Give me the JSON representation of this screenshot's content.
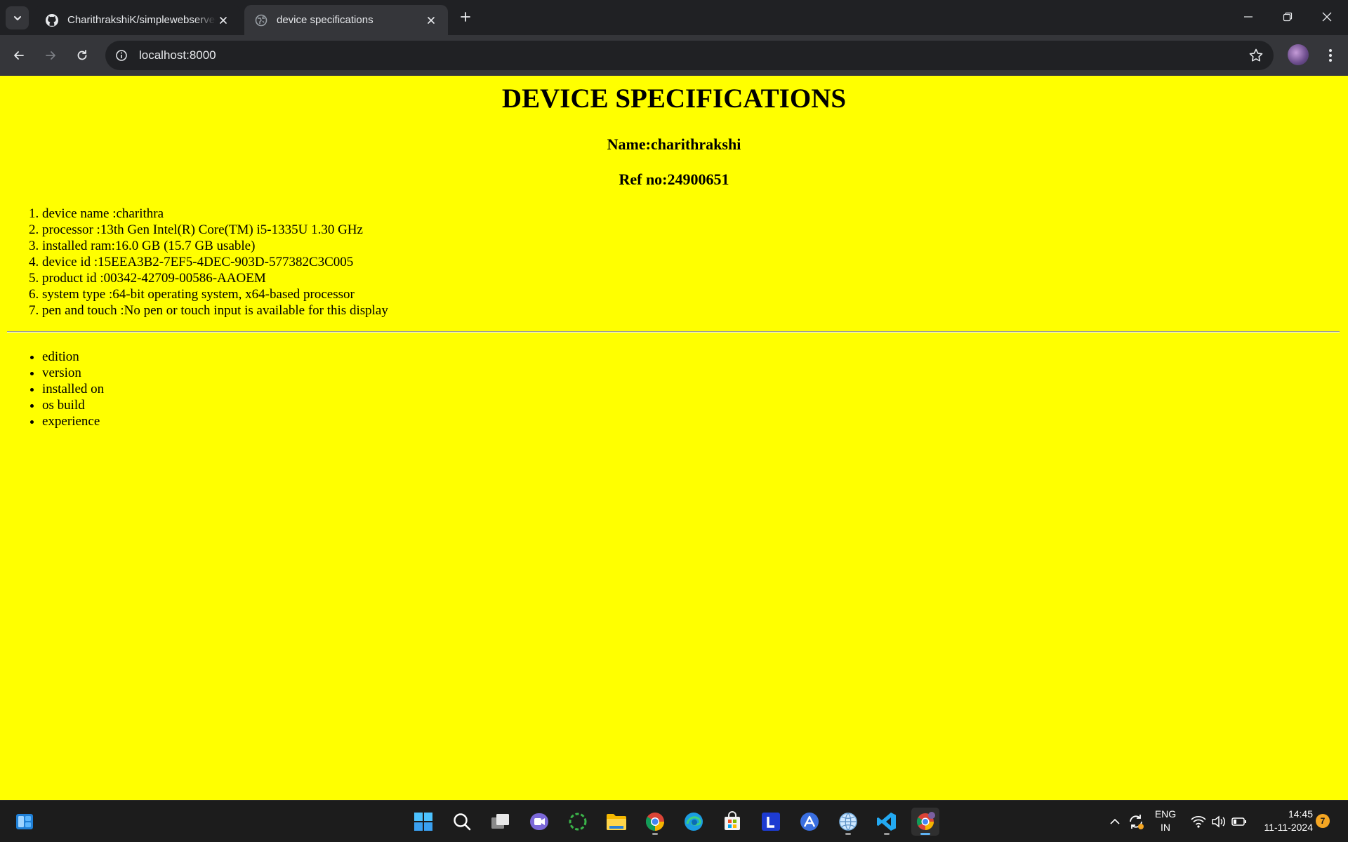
{
  "browser": {
    "tabs": [
      {
        "title": "CharithrakshiK/simplewebserver",
        "active": false
      },
      {
        "title": "device specifications",
        "active": true
      }
    ],
    "url": "localhost:8000"
  },
  "page": {
    "heading": "DEVICE SPECIFICATIONS",
    "name_line": "Name:charithrakshi",
    "ref_line": "Ref no:24900651",
    "specs": [
      "device name :charithra",
      "processor :13th Gen Intel(R) Core(TM) i5-1335U 1.30 GHz",
      "installed ram:16.0 GB (15.7 GB usable)",
      "device id :15EEA3B2-7EF5-4DEC-903D-577382C3C005",
      "product id :00342-42709-00586-AAOEM",
      "system type :64-bit operating system, x64-based processor",
      "pen and touch :No pen or touch input is available for this display"
    ],
    "windows_items": [
      "edition",
      "version",
      "installed on",
      "os build",
      "experience"
    ],
    "background_color": "#ffff00"
  },
  "taskbar": {
    "apps": [
      "start-icon",
      "search-icon",
      "task-view-icon",
      "teams-icon",
      "loading-app-icon",
      "file-explorer-icon",
      "chrome-icon",
      "edge-icon",
      "store-icon",
      "l-app-icon",
      "arc-app-icon",
      "globe-app-icon",
      "vscode-icon",
      "chrome-profile-icon"
    ],
    "language_top": "ENG",
    "language_bottom": "IN",
    "time": "14:45",
    "date": "11-11-2024",
    "notification_count": "7"
  }
}
